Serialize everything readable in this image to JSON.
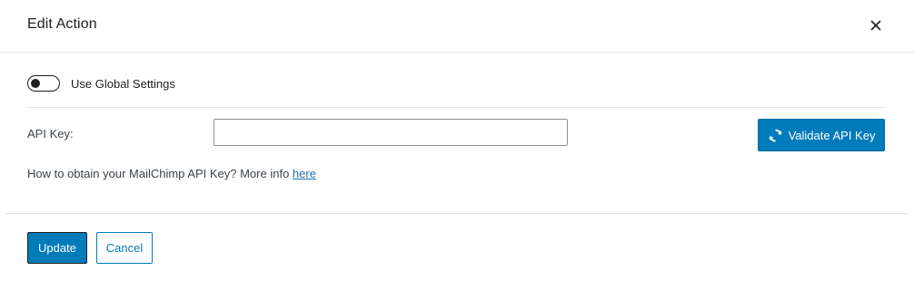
{
  "modal": {
    "title": "Edit Action"
  },
  "toggle": {
    "label": "Use Global Settings",
    "checked": false
  },
  "api_key": {
    "label": "API Key:",
    "value": "",
    "placeholder": ""
  },
  "validate_button": {
    "label": "Validate API Key",
    "icon": "refresh-icon"
  },
  "help": {
    "text": "How to obtain your MailChimp API Key? More info ",
    "link_text": "here"
  },
  "footer": {
    "update_label": "Update",
    "cancel_label": "Cancel"
  },
  "colors": {
    "primary": "#007cba",
    "link": "#2271b1",
    "border": "#8c8f94",
    "divider": "#e2e4e7"
  }
}
